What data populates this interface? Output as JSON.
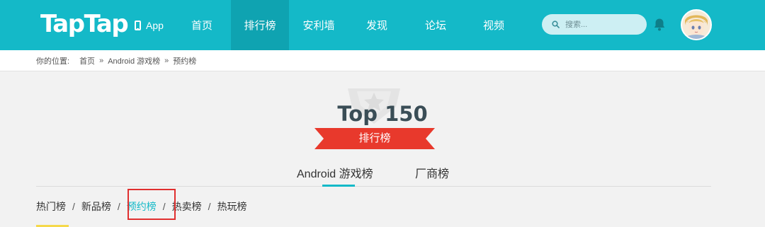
{
  "header": {
    "logo": "TapTap",
    "app_label": "App",
    "nav": [
      "首页",
      "排行榜",
      "安利墙",
      "发现",
      "论坛",
      "视频"
    ],
    "active_nav": "排行榜",
    "search_placeholder": "搜索..."
  },
  "breadcrumb": {
    "label": "你的位置:",
    "items": [
      "首页",
      "Android 游戏榜",
      "预约榜"
    ],
    "separator": "»"
  },
  "hero": {
    "title": "Top 150",
    "ribbon": "排行榜"
  },
  "tabs": [
    "Android 游戏榜",
    "厂商榜"
  ],
  "subtabs": {
    "items": [
      "热门榜",
      "新品榜",
      "预约榜",
      "热卖榜",
      "热玩榜"
    ],
    "separator": "/",
    "active": "预约榜"
  },
  "colors": {
    "brand": "#14b9c8",
    "ribbon": "#e8392c",
    "highlight": "#e02f2f"
  }
}
